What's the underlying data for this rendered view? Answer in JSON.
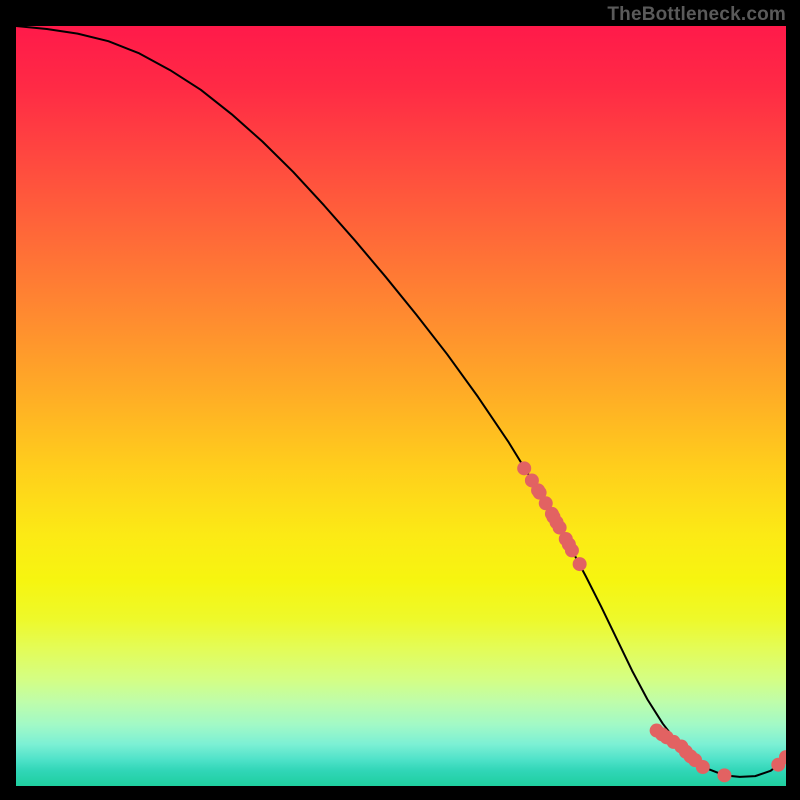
{
  "watermark": "TheBottleneck.com",
  "chart_data": {
    "type": "line",
    "title": "",
    "xlabel": "",
    "ylabel": "",
    "xlim": [
      0,
      100
    ],
    "ylim": [
      0,
      100
    ],
    "grid": false,
    "legend": false,
    "series": [
      {
        "name": "bottleneck-curve",
        "x": [
          0,
          4,
          8,
          12,
          16,
          20,
          24,
          28,
          32,
          36,
          40,
          44,
          48,
          52,
          56,
          60,
          64,
          68,
          72,
          74,
          76,
          78,
          80,
          82,
          84,
          86,
          88,
          90,
          92,
          94,
          96,
          98,
          99,
          100
        ],
        "y": [
          100,
          99.6,
          99.0,
          98.0,
          96.4,
          94.2,
          91.6,
          88.4,
          84.8,
          80.8,
          76.4,
          71.8,
          67.0,
          62.0,
          56.8,
          51.2,
          45.2,
          38.6,
          31.4,
          27.6,
          23.6,
          19.4,
          15.2,
          11.4,
          8.2,
          5.6,
          3.6,
          2.2,
          1.4,
          1.2,
          1.3,
          2.0,
          2.8,
          3.8
        ],
        "color": "#000000",
        "stroke_width": 2
      }
    ],
    "markers": [
      {
        "name": "cluster-descent",
        "color": "#e26262",
        "radius": 7,
        "points": [
          {
            "x": 66.0,
            "y": 41.8
          },
          {
            "x": 67.0,
            "y": 40.2
          },
          {
            "x": 67.8,
            "y": 38.9
          },
          {
            "x": 68.0,
            "y": 38.6
          },
          {
            "x": 68.8,
            "y": 37.2
          },
          {
            "x": 69.6,
            "y": 35.8
          },
          {
            "x": 69.8,
            "y": 35.4
          },
          {
            "x": 70.2,
            "y": 34.7
          },
          {
            "x": 70.6,
            "y": 34.0
          },
          {
            "x": 71.4,
            "y": 32.5
          },
          {
            "x": 71.8,
            "y": 31.8
          },
          {
            "x": 72.2,
            "y": 31.0
          },
          {
            "x": 73.2,
            "y": 29.2
          }
        ]
      },
      {
        "name": "cluster-bottom",
        "color": "#e26262",
        "radius": 7,
        "points": [
          {
            "x": 83.2,
            "y": 7.3
          },
          {
            "x": 83.9,
            "y": 6.8
          },
          {
            "x": 84.5,
            "y": 6.4
          },
          {
            "x": 85.4,
            "y": 5.8
          },
          {
            "x": 86.4,
            "y": 5.2
          },
          {
            "x": 87.0,
            "y": 4.5
          },
          {
            "x": 87.6,
            "y": 3.9
          },
          {
            "x": 88.2,
            "y": 3.4
          },
          {
            "x": 89.2,
            "y": 2.5
          },
          {
            "x": 92.0,
            "y": 1.4
          }
        ]
      },
      {
        "name": "cluster-upturn",
        "color": "#e26262",
        "radius": 7,
        "points": [
          {
            "x": 99.0,
            "y": 2.8
          },
          {
            "x": 100.0,
            "y": 3.8
          }
        ]
      }
    ],
    "background": {
      "type": "vertical_gradient",
      "stops": [
        {
          "pos": 0.0,
          "hex": "#ff1a4a"
        },
        {
          "pos": 0.38,
          "hex": "#ff8a30"
        },
        {
          "pos": 0.67,
          "hex": "#fcea15"
        },
        {
          "pos": 0.86,
          "hex": "#d4fe84"
        },
        {
          "pos": 1.0,
          "hex": "#1fcf9f"
        }
      ]
    }
  }
}
